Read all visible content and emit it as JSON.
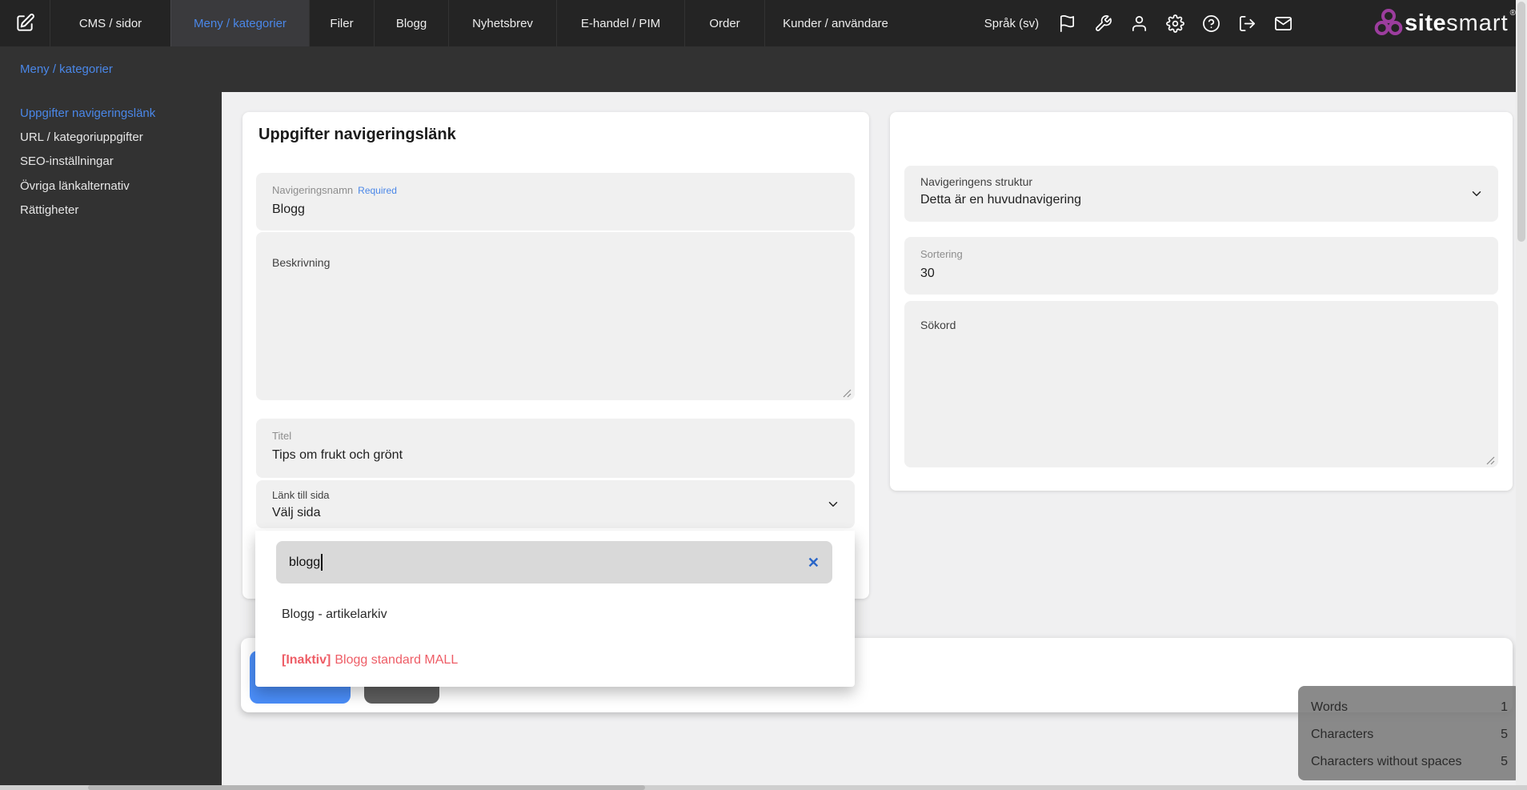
{
  "header": {
    "tabs": [
      {
        "label": "CMS / sidor"
      },
      {
        "label": "Meny / kategorier"
      },
      {
        "label": "Filer"
      },
      {
        "label": "Blogg"
      },
      {
        "label": "Nyhetsbrev"
      },
      {
        "label": "E-handel / PIM"
      },
      {
        "label": "Order"
      },
      {
        "label": "Kunder / användare"
      }
    ],
    "active_tab": "Meny / kategorier",
    "language_label": "Språk (sv)",
    "icons": [
      "edit-icon",
      "flag-icon",
      "wrench-icon",
      "user-icon",
      "gear-icon",
      "help-icon",
      "logout-icon",
      "mail-icon"
    ],
    "logo": {
      "site": "site",
      "smart": "smart",
      "registered": "®"
    }
  },
  "subheader": {
    "title": "Meny / kategorier"
  },
  "sidebar": {
    "items": [
      {
        "label": "Uppgifter navigeringslänk",
        "active": true
      },
      {
        "label": "URL / kategoriuppgifter",
        "active": false
      },
      {
        "label": "SEO-inställningar",
        "active": false
      },
      {
        "label": "Övriga länkalternativ",
        "active": false
      },
      {
        "label": "Rättigheter",
        "active": false
      }
    ]
  },
  "form": {
    "title": "Uppgifter navigeringslänk",
    "nav_name": {
      "label": "Navigeringsnamn",
      "required_badge": "Required",
      "value": "Blogg"
    },
    "description": {
      "label": "Beskrivning",
      "value": ""
    },
    "titel": {
      "label": "Titel",
      "value": "Tips om frukt och grönt"
    },
    "link_page": {
      "label": "Länk till sida",
      "value": "Välj sida"
    }
  },
  "dropdown": {
    "search_value": "blogg",
    "options": [
      {
        "prefix": "",
        "text": "Blogg - artikelarkiv",
        "inactive": false
      },
      {
        "prefix": "[Inaktiv]",
        "text": "Blogg standard MALL",
        "inactive": true
      }
    ]
  },
  "right_form": {
    "structure": {
      "label": "Navigeringens struktur",
      "value": "Detta är en huvudnavigering"
    },
    "sorting": {
      "label": "Sortering",
      "value": "30"
    },
    "keywords": {
      "label": "Sökord",
      "value": ""
    }
  },
  "counter": {
    "rows": [
      {
        "label": "Words",
        "value": "1"
      },
      {
        "label": "Characters",
        "value": "5"
      },
      {
        "label": "Characters without spaces",
        "value": "5"
      }
    ]
  },
  "colors": {
    "accent_blue": "#4a87e8",
    "primary_button": "#4a8df8",
    "secondary_button": "#5e5e5e",
    "inactive_option_red": "#ee5d66",
    "logo_purple": "#9c3d9e"
  }
}
